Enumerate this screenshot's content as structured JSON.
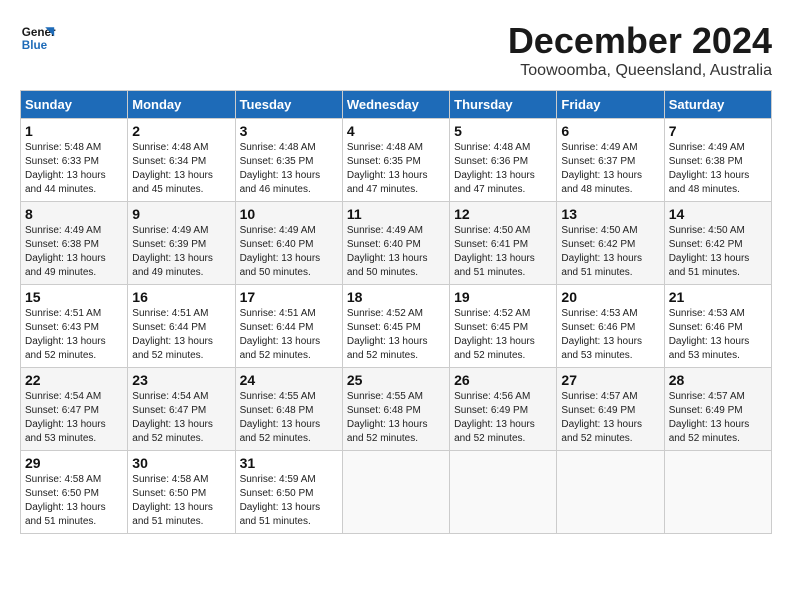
{
  "logo": {
    "line1": "General",
    "line2": "Blue"
  },
  "title": "December 2024",
  "location": "Toowoomba, Queensland, Australia",
  "days_of_week": [
    "Sunday",
    "Monday",
    "Tuesday",
    "Wednesday",
    "Thursday",
    "Friday",
    "Saturday"
  ],
  "weeks": [
    [
      {
        "num": "1",
        "sunrise": "5:48 AM",
        "sunset": "6:33 PM",
        "daylight": "13 hours and 44 minutes."
      },
      {
        "num": "2",
        "sunrise": "4:48 AM",
        "sunset": "6:34 PM",
        "daylight": "13 hours and 45 minutes."
      },
      {
        "num": "3",
        "sunrise": "4:48 AM",
        "sunset": "6:35 PM",
        "daylight": "13 hours and 46 minutes."
      },
      {
        "num": "4",
        "sunrise": "4:48 AM",
        "sunset": "6:35 PM",
        "daylight": "13 hours and 47 minutes."
      },
      {
        "num": "5",
        "sunrise": "4:48 AM",
        "sunset": "6:36 PM",
        "daylight": "13 hours and 47 minutes."
      },
      {
        "num": "6",
        "sunrise": "4:49 AM",
        "sunset": "6:37 PM",
        "daylight": "13 hours and 48 minutes."
      },
      {
        "num": "7",
        "sunrise": "4:49 AM",
        "sunset": "6:38 PM",
        "daylight": "13 hours and 48 minutes."
      }
    ],
    [
      {
        "num": "8",
        "sunrise": "4:49 AM",
        "sunset": "6:38 PM",
        "daylight": "13 hours and 49 minutes."
      },
      {
        "num": "9",
        "sunrise": "4:49 AM",
        "sunset": "6:39 PM",
        "daylight": "13 hours and 49 minutes."
      },
      {
        "num": "10",
        "sunrise": "4:49 AM",
        "sunset": "6:40 PM",
        "daylight": "13 hours and 50 minutes."
      },
      {
        "num": "11",
        "sunrise": "4:49 AM",
        "sunset": "6:40 PM",
        "daylight": "13 hours and 50 minutes."
      },
      {
        "num": "12",
        "sunrise": "4:50 AM",
        "sunset": "6:41 PM",
        "daylight": "13 hours and 51 minutes."
      },
      {
        "num": "13",
        "sunrise": "4:50 AM",
        "sunset": "6:42 PM",
        "daylight": "13 hours and 51 minutes."
      },
      {
        "num": "14",
        "sunrise": "4:50 AM",
        "sunset": "6:42 PM",
        "daylight": "13 hours and 51 minutes."
      }
    ],
    [
      {
        "num": "15",
        "sunrise": "4:51 AM",
        "sunset": "6:43 PM",
        "daylight": "13 hours and 52 minutes."
      },
      {
        "num": "16",
        "sunrise": "4:51 AM",
        "sunset": "6:44 PM",
        "daylight": "13 hours and 52 minutes."
      },
      {
        "num": "17",
        "sunrise": "4:51 AM",
        "sunset": "6:44 PM",
        "daylight": "13 hours and 52 minutes."
      },
      {
        "num": "18",
        "sunrise": "4:52 AM",
        "sunset": "6:45 PM",
        "daylight": "13 hours and 52 minutes."
      },
      {
        "num": "19",
        "sunrise": "4:52 AM",
        "sunset": "6:45 PM",
        "daylight": "13 hours and 52 minutes."
      },
      {
        "num": "20",
        "sunrise": "4:53 AM",
        "sunset": "6:46 PM",
        "daylight": "13 hours and 53 minutes."
      },
      {
        "num": "21",
        "sunrise": "4:53 AM",
        "sunset": "6:46 PM",
        "daylight": "13 hours and 53 minutes."
      }
    ],
    [
      {
        "num": "22",
        "sunrise": "4:54 AM",
        "sunset": "6:47 PM",
        "daylight": "13 hours and 53 minutes."
      },
      {
        "num": "23",
        "sunrise": "4:54 AM",
        "sunset": "6:47 PM",
        "daylight": "13 hours and 52 minutes."
      },
      {
        "num": "24",
        "sunrise": "4:55 AM",
        "sunset": "6:48 PM",
        "daylight": "13 hours and 52 minutes."
      },
      {
        "num": "25",
        "sunrise": "4:55 AM",
        "sunset": "6:48 PM",
        "daylight": "13 hours and 52 minutes."
      },
      {
        "num": "26",
        "sunrise": "4:56 AM",
        "sunset": "6:49 PM",
        "daylight": "13 hours and 52 minutes."
      },
      {
        "num": "27",
        "sunrise": "4:57 AM",
        "sunset": "6:49 PM",
        "daylight": "13 hours and 52 minutes."
      },
      {
        "num": "28",
        "sunrise": "4:57 AM",
        "sunset": "6:49 PM",
        "daylight": "13 hours and 52 minutes."
      }
    ],
    [
      {
        "num": "29",
        "sunrise": "4:58 AM",
        "sunset": "6:50 PM",
        "daylight": "13 hours and 51 minutes."
      },
      {
        "num": "30",
        "sunrise": "4:58 AM",
        "sunset": "6:50 PM",
        "daylight": "13 hours and 51 minutes."
      },
      {
        "num": "31",
        "sunrise": "4:59 AM",
        "sunset": "6:50 PM",
        "daylight": "13 hours and 51 minutes."
      },
      null,
      null,
      null,
      null
    ]
  ],
  "labels": {
    "sunrise": "Sunrise:",
    "sunset": "Sunset:",
    "daylight": "Daylight:"
  }
}
